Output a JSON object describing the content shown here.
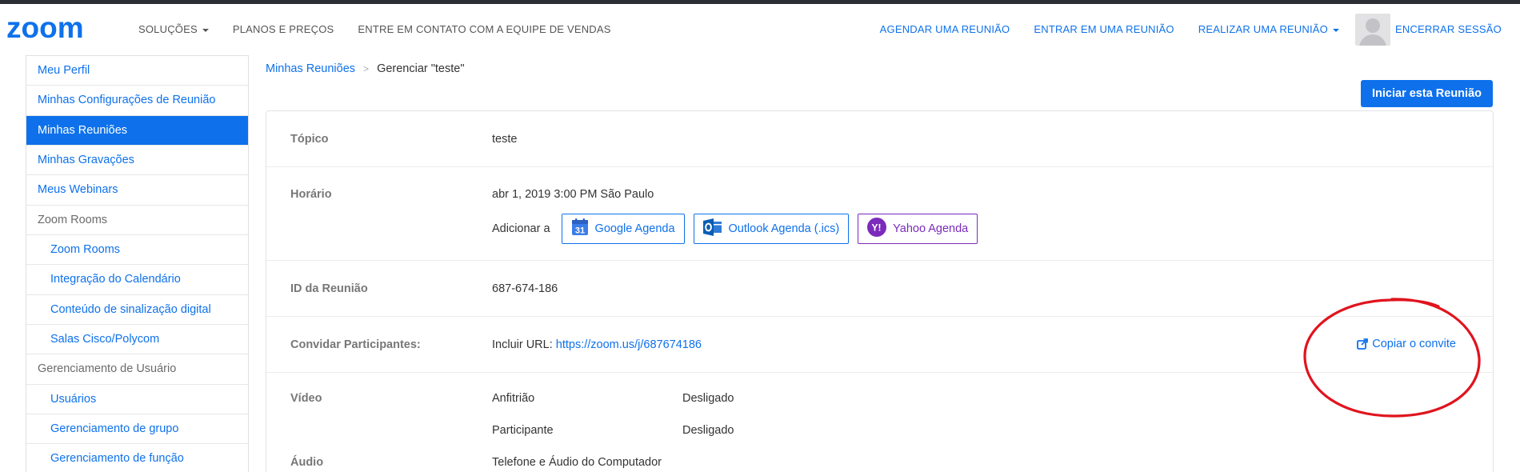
{
  "nav": {
    "logo_text": "zoom",
    "left": [
      {
        "label": "SOLUÇÕES",
        "has_caret": true
      },
      {
        "label": "PLANOS E PREÇOS"
      },
      {
        "label": "ENTRE EM CONTATO COM A EQUIPE DE VENDAS"
      }
    ],
    "right": [
      {
        "label": "AGENDAR UMA REUNIÃO"
      },
      {
        "label": "ENTRAR EM UMA REUNIÃO"
      },
      {
        "label": "REALIZAR UMA REUNIÃO",
        "has_caret": true
      }
    ],
    "avatar_icon": "user-avatar-icon",
    "logout": "ENCERRAR SESSÃO"
  },
  "sidebar": {
    "items": [
      {
        "label": "Meu Perfil"
      },
      {
        "label": "Minhas Configurações de Reunião"
      },
      {
        "label": "Minhas Reuniões",
        "active": true
      },
      {
        "label": "Minhas Gravações"
      },
      {
        "label": "Meus Webinars"
      },
      {
        "label": "Zoom Rooms",
        "header": true
      },
      {
        "label": "Zoom Rooms",
        "sub": true
      },
      {
        "label": "Integração do Calendário",
        "sub": true
      },
      {
        "label": "Conteúdo de sinalização digital",
        "sub": true
      },
      {
        "label": "Salas Cisco/Polycom",
        "sub": true
      },
      {
        "label": "Gerenciamento de Usuário",
        "header": true
      },
      {
        "label": "Usuários",
        "sub": true
      },
      {
        "label": "Gerenciamento de grupo",
        "sub": true
      },
      {
        "label": "Gerenciamento de função",
        "sub": true
      }
    ]
  },
  "breadcrumb": {
    "parent": "Minhas Reuniões",
    "separator": ">",
    "current": "Gerenciar \"teste\""
  },
  "actions": {
    "start_meeting": "Iniciar esta Reunião"
  },
  "details": {
    "topic": {
      "label": "Tópico",
      "value": "teste"
    },
    "time": {
      "label": "Horário",
      "value": "abr 1, 2019 3:00 PM São Paulo",
      "add_to": "Adicionar a",
      "calendars": {
        "google": {
          "label": "Google Agenda",
          "icon": "google-calendar-icon",
          "color": "#0e71eb"
        },
        "outlook": {
          "label": "Outlook Agenda (.ics)",
          "icon": "outlook-icon",
          "color": "#0e71eb"
        },
        "yahoo": {
          "label": "Yahoo Agenda",
          "icon": "yahoo-icon",
          "color": "#7b2bbb"
        }
      }
    },
    "meeting_id": {
      "label": "ID da Reunião",
      "value": "687-674-186"
    },
    "invite": {
      "label": "Convidar Participantes:",
      "url_prefix": "Incluir URL:",
      "url": "https://zoom.us/j/687674186",
      "copy_label": "Copiar o convite",
      "copy_icon": "external-share-icon"
    },
    "video": {
      "label": "Vídeo",
      "host_label": "Anfitrião",
      "host_value": "Desligado",
      "participant_label": "Participante",
      "participant_value": "Desligado"
    },
    "audio": {
      "label": "Áudio",
      "value": "Telefone e Áudio do Computador"
    }
  },
  "colors": {
    "accent": "#0e71eb",
    "yahoo": "#7b2bbb",
    "annotation": "#e0141e"
  }
}
